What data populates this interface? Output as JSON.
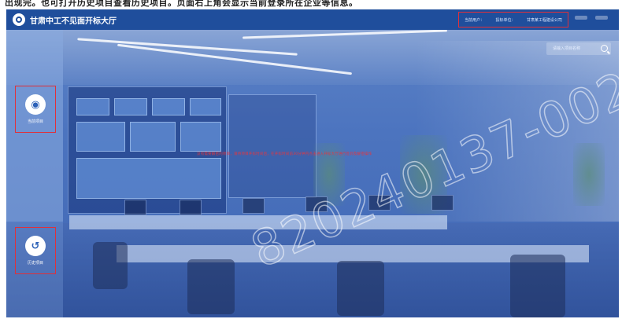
{
  "top_text": "出现完。也可打开历史项目查看历史项目。页面右上角会显示当前登录所在企业等信息。",
  "header": {
    "site_title": "甘肃中工不见面开标大厅",
    "user_info": [
      "当前用户：",
      "投标单位：",
      "甘肃某工程建设公司"
    ]
  },
  "search": {
    "placeholder": "请输入项目名称",
    "icon": "search-icon"
  },
  "sidebar": {
    "items": [
      {
        "label": "当前项目",
        "icon": "cube-icon",
        "glyph": "◉"
      },
      {
        "label": "历史项目",
        "icon": "history-icon",
        "glyph": "↺"
      }
    ]
  },
  "notice": "没有需要解密的项目，请待项目开标时间后，在开标时间前30分钟内点击进入开标大厅进行签到及解密操作",
  "watermark": "820240137-002",
  "colors": {
    "header_bg": "#1f4e9c",
    "highlight": "#e0303a",
    "overlay": "#4c74bf",
    "notice": "#e8343d"
  }
}
